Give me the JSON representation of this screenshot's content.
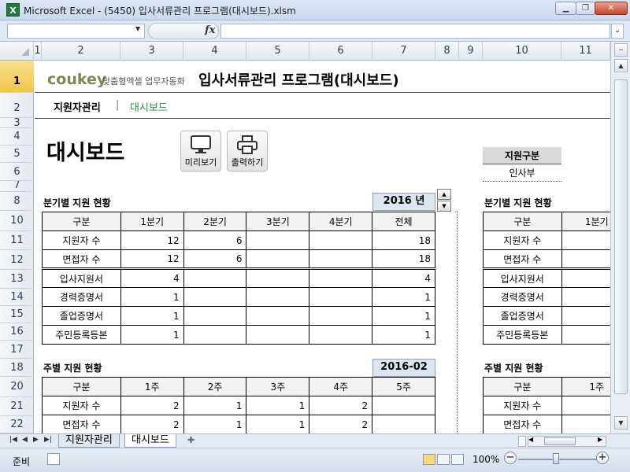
{
  "window": {
    "title": "Microsoft Excel - (5450) 입사서류관리 프로그램(대시보드).xlsm",
    "icon_letter": "X",
    "minimize": "▁",
    "restore": "❐",
    "close": "✕"
  },
  "formula_bar": {
    "name_value": "",
    "fx": "fx",
    "formula_value": ""
  },
  "columns": [
    "1",
    "2",
    "3",
    "4",
    "5",
    "6",
    "7",
    "8",
    "9",
    "10",
    "11"
  ],
  "rows": [
    "1",
    "2",
    "3",
    "4",
    "5",
    "6",
    "7",
    "8",
    "10",
    "11",
    "12",
    "13",
    "14",
    "15",
    "16",
    "17",
    "18",
    "20",
    "21",
    "22"
  ],
  "header": {
    "brand": "coukey",
    "brand_tagline": "맞춤형엑셀 업무자동화",
    "program_title": "입사서류관리 프로그램(대시보드)"
  },
  "nav": {
    "item1": "지원자관리",
    "separator": "|",
    "item2": "대시보드"
  },
  "dashboard": {
    "title": "대시보드",
    "preview_label": "미리보기",
    "print_label": "출력하기"
  },
  "filter": {
    "label": "지원구분",
    "value": "인사부"
  },
  "quarterly": {
    "title": "분기별 지원 현황",
    "year": "2016 년",
    "headers": [
      "구분",
      "1분기",
      "2분기",
      "3분기",
      "4분기",
      "전체"
    ],
    "rows": [
      [
        "지원자 수",
        "12",
        "6",
        "",
        "",
        "18"
      ],
      [
        "면접자 수",
        "12",
        "6",
        "",
        "",
        "18"
      ],
      [
        "입사지원서",
        "4",
        "",
        "",
        "",
        "4"
      ],
      [
        "경력증명서",
        "1",
        "",
        "",
        "",
        "1"
      ],
      [
        "졸업증명서",
        "1",
        "",
        "",
        "",
        "1"
      ],
      [
        "주민등록등본",
        "1",
        "",
        "",
        "",
        "1"
      ]
    ]
  },
  "weekly": {
    "title": "주별 지원 현황",
    "period": "2016-02",
    "headers": [
      "구분",
      "1주",
      "2주",
      "3주",
      "4주",
      "5주"
    ],
    "rows": [
      [
        "지원자 수",
        "2",
        "1",
        "1",
        "2",
        ""
      ],
      [
        "면접자 수",
        "2",
        "1",
        "1",
        "2",
        ""
      ]
    ]
  },
  "right_quarterly": {
    "title": "분기별 지원 현황",
    "headers": [
      "구분",
      "1분기"
    ],
    "rows": [
      "지원자 수",
      "면접자 수",
      "입사지원서",
      "경력증명서",
      "졸업증명서",
      "주민등록등본"
    ]
  },
  "right_weekly": {
    "title": "주별 지원 현황",
    "headers": [
      "구분",
      "1주"
    ],
    "rows": [
      "지원자 수",
      "면접자 수"
    ]
  },
  "sheet_tabs": [
    "지원자관리",
    "대시보드"
  ],
  "status": {
    "ready": "준비",
    "zoom": "100%",
    "zoom_minus": "−",
    "zoom_plus": "+"
  }
}
